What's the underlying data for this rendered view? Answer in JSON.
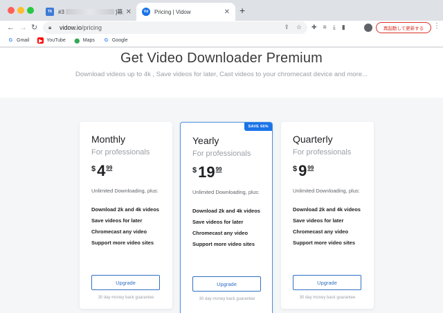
{
  "browser": {
    "tabs": [
      {
        "favicon": "T6",
        "title_prefix": "#3",
        "title_suffix": "]幕删计",
        "active": false
      },
      {
        "favicon": "Vd",
        "title": "Pricing | Vidow",
        "active": true
      }
    ],
    "url_host": "vidow.io",
    "url_path": "/pricing",
    "relaunch_label": "再起動して更新する",
    "bookmarks": [
      {
        "label": "Gmail",
        "icon": "google-icon"
      },
      {
        "label": "YouTube",
        "icon": "youtube-icon"
      },
      {
        "label": "Maps",
        "icon": "maps-icon"
      },
      {
        "label": "Google",
        "icon": "google-icon"
      }
    ]
  },
  "page": {
    "heading": "Get Video Downloader Premium",
    "subheading": "Download videos up to 4k , Save videos for later, Cast videos to your chromecast device and more...",
    "plans": [
      {
        "name": "Monthly",
        "audience": "For professionals",
        "currency": "$",
        "price": "4",
        "cents": "99",
        "intro": "Unlimited Downloading, plus:",
        "features": [
          "Download 2k and 4k videos",
          "Save videos for later",
          "Chromecast any video",
          "Support more video sites"
        ],
        "button": "Upgrade",
        "guarantee": "30 day money back guarantee"
      },
      {
        "name": "Yearly",
        "badge": "SAVE 66%",
        "audience": "For professionals",
        "currency": "$",
        "price": "19",
        "cents": "99",
        "intro": "Unlimited Downloading, plus:",
        "features": [
          "Download 2k and 4k videos",
          "Save videos for later",
          "Chromecast any video",
          "Support more video sites"
        ],
        "button": "Upgrade",
        "guarantee": "30 day money back guarantee"
      },
      {
        "name": "Quarterly",
        "audience": "For professionals",
        "currency": "$",
        "price": "9",
        "cents": "99",
        "intro": "Unlimited Downloading, plus:",
        "features": [
          "Download 2k and 4k videos",
          "Save videos for later",
          "Chromecast any video",
          "Support more video sites"
        ],
        "button": "Upgrade",
        "guarantee": "30 day money back guarantee"
      }
    ]
  },
  "colors": {
    "accent": "#2f6fc4",
    "badge": "#1a73e8",
    "relaunch": "#d93025"
  }
}
